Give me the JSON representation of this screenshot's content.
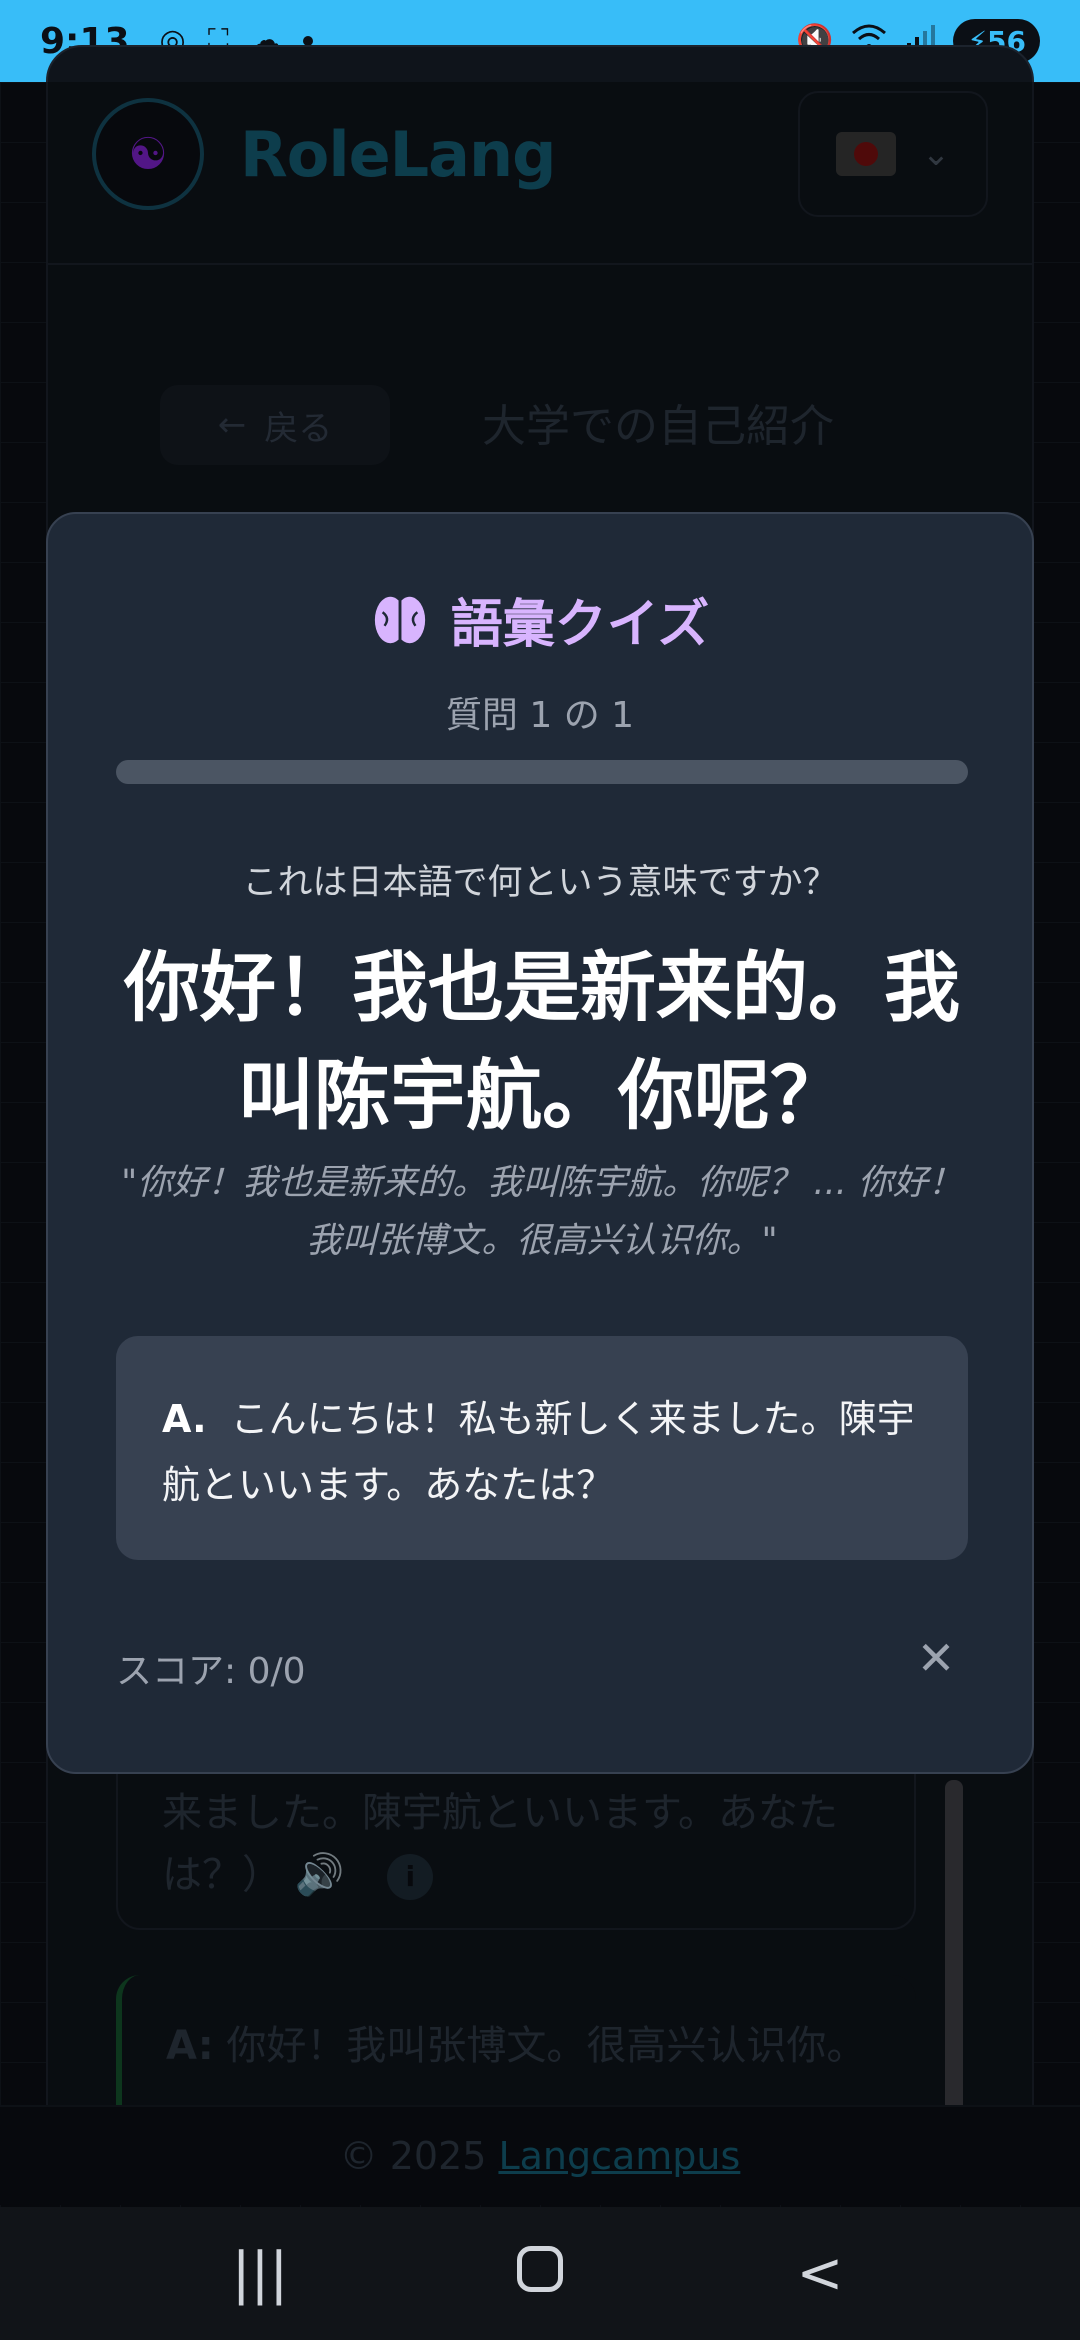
{
  "status_bar": {
    "time": "9:13",
    "battery": "56",
    "icons_left": [
      "chrome-icon",
      "screenshot-icon",
      "cloud-icon",
      "dot-icon"
    ],
    "icons_right": [
      "mute-icon",
      "wifi-icon",
      "signal-icon",
      "battery-charging-icon"
    ]
  },
  "app": {
    "brand": "RoleLang",
    "language_flag": "japan-flag",
    "back_label": "戻る",
    "scene_title": "大学での自己紹介",
    "bg_bubble_text": "来ました。陳宇航といいます。あなたは？）",
    "bg_bubble2_speaker": "A:",
    "bg_bubble2_text": "你好！我叫张博文。很高兴认识你。",
    "footer_text": "© 2025",
    "footer_link": "Langcampus"
  },
  "quiz": {
    "title": "語彙クイズ",
    "progress_label": "質問 1 の 1",
    "progress": 0.0,
    "prompt": "これは日本語で何という意味ですか？",
    "question": "你好！我也是新来的。我叫陈宇航。你呢？",
    "context": "\"你好！我也是新来的。我叫陈宇航。你呢？ ... 你好！我叫张博文。很高兴认识你。\"",
    "options": [
      {
        "letter": "A.",
        "text": "こんにちは！私も新しく来ました。陳宇航といいます。あなたは？"
      }
    ],
    "score": "スコア: 0/0",
    "close": "✕"
  },
  "nav": {
    "recents": "|||",
    "back": "<"
  },
  "colors": {
    "status_bar": "#38bdf8",
    "modal_bg": "#1f2937",
    "accent_purple": "#d8b4fe",
    "option_bg": "#374151"
  }
}
